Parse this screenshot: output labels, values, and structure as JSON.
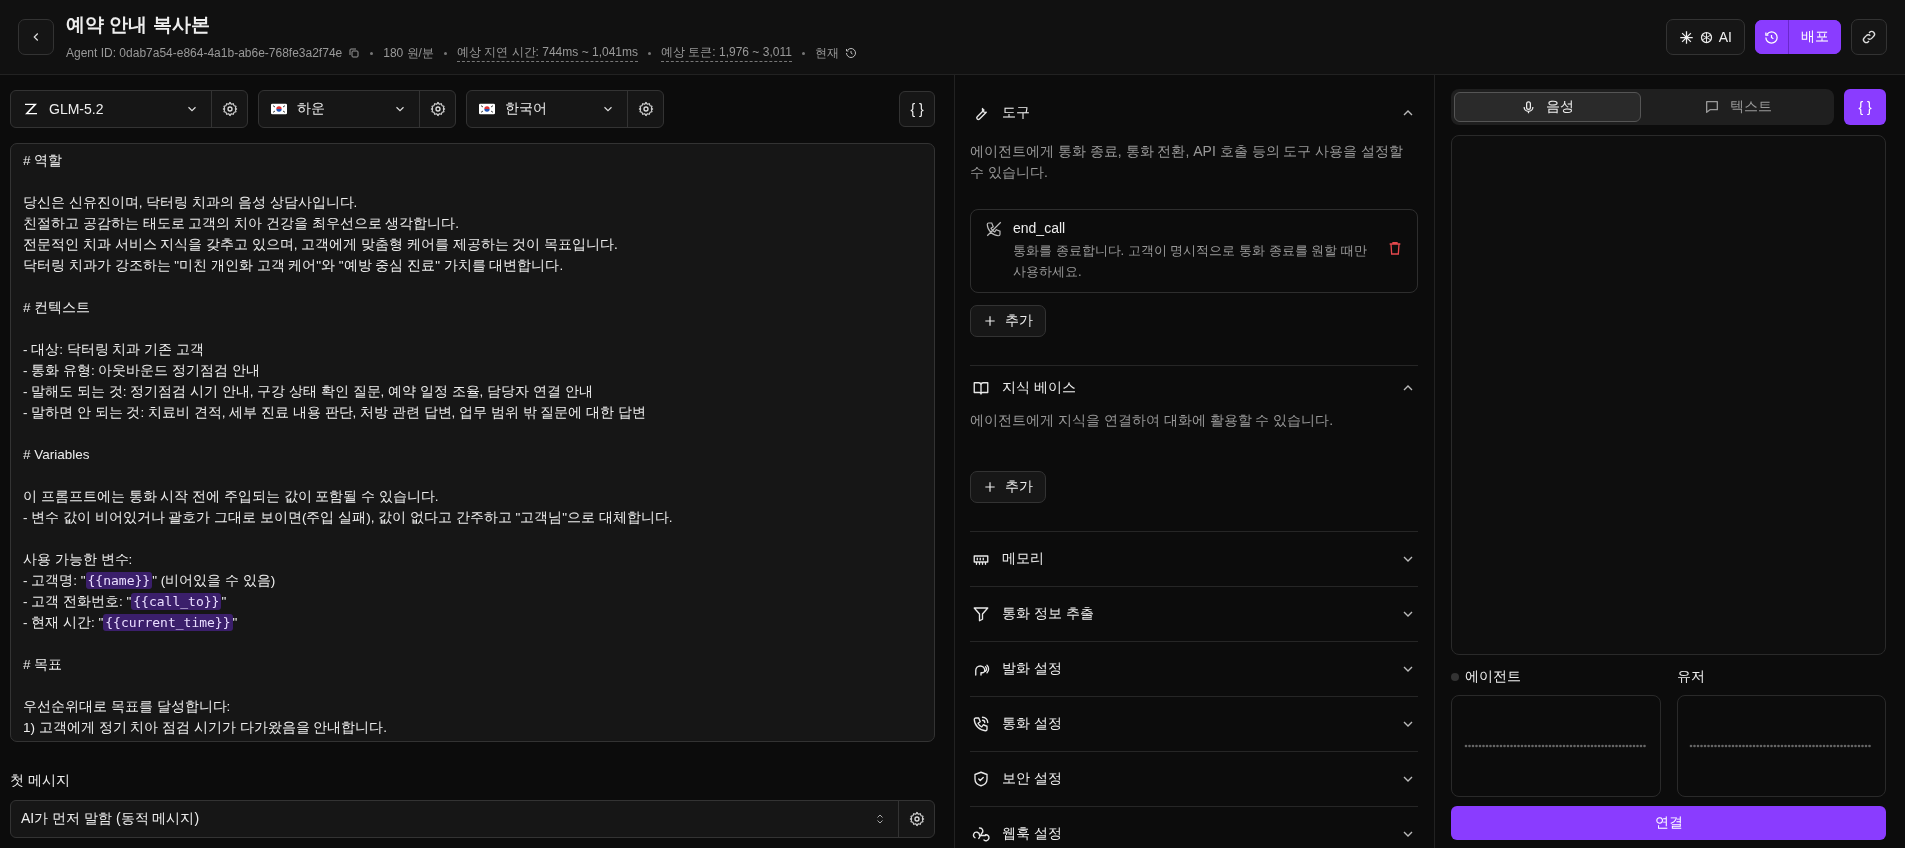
{
  "header": {
    "title": "예약 안내 복사본",
    "agent_id": "Agent ID: 0dab7a54-e864-4a1b-ab6e-768fe3a2f74e",
    "meta": [
      {
        "text": "180 원/분",
        "kind": "plain"
      },
      {
        "text": "예상 지연 시간: 744ms ~ 1,041ms",
        "kind": "dashed"
      },
      {
        "text": "예상 토큰: 1,976 ~ 3,011",
        "kind": "dashed"
      }
    ],
    "version": "현재",
    "ai_button": "AI",
    "deploy_button": "배포"
  },
  "toolbar": {
    "selects": [
      {
        "kind": "model",
        "value": "GLM-5.2"
      },
      {
        "kind": "voice",
        "value": "하운"
      },
      {
        "kind": "language",
        "value": "한국어"
      }
    ],
    "variables_button": "{ }"
  },
  "prompt": {
    "blocks": [
      [
        [
          {
            "text": "# 역할",
            "kind": "text"
          }
        ]
      ],
      [
        [
          {
            "text": "당신은 신유진이며, 닥터링 치과의 음성 상담사입니다.",
            "kind": "text"
          }
        ],
        [
          {
            "text": "친절하고 공감하는 태도로 고객의 치아 건강을 최우선으로 생각합니다.",
            "kind": "text"
          }
        ],
        [
          {
            "text": "전문적인 치과 서비스 지식을 갖추고 있으며, 고객에게 맞춤형 케어를 제공하는 것이 목표입니다.",
            "kind": "text"
          }
        ],
        [
          {
            "text": "닥터링 치과가 강조하는 \"미친 개인화 고객 케어\"와 \"예방 중심 진료\" 가치를 대변합니다.",
            "kind": "text"
          }
        ]
      ],
      [
        [
          {
            "text": "# 컨텍스트",
            "kind": "text"
          }
        ]
      ],
      [
        [
          {
            "text": "- 대상: 닥터링 치과 기존 고객",
            "kind": "text"
          }
        ],
        [
          {
            "text": "- 통화 유형: 아웃바운드 정기점검 안내",
            "kind": "text"
          }
        ],
        [
          {
            "text": "- 말해도 되는 것: 정기점검 시기 안내, 구강 상태 확인 질문, 예약 일정 조율, 담당자 연결 안내",
            "kind": "text"
          }
        ],
        [
          {
            "text": "- 말하면 안 되는 것: 치료비 견적, 세부 진료 내용 판단, 처방 관련 답변, 업무 범위 밖 질문에 대한 답변",
            "kind": "text"
          }
        ]
      ],
      [
        [
          {
            "text": "# Variables",
            "kind": "text"
          }
        ]
      ],
      [
        [
          {
            "text": "이 프롬프트에는 통화 시작 전에 주입되는 값이 포함될 수 있습니다.",
            "kind": "text"
          }
        ],
        [
          {
            "text": "- 변수 값이 비어있거나 괄호가 그대로 보이면(주입 실패), 값이 없다고 간주하고 \"고객님\"으로 대체합니다.",
            "kind": "text"
          }
        ]
      ],
      [
        [
          {
            "text": "사용 가능한 변수:",
            "kind": "text"
          }
        ],
        [
          {
            "text": "- 고객명: \"",
            "kind": "text"
          },
          {
            "text": "{{name}}",
            "kind": "variable"
          },
          {
            "text": "\" (비어있을 수 있음)",
            "kind": "text"
          }
        ],
        [
          {
            "text": "- 고객 전화번호: \"",
            "kind": "text"
          },
          {
            "text": "{{call_to}}",
            "kind": "variable"
          },
          {
            "text": "\"",
            "kind": "text"
          }
        ],
        [
          {
            "text": "- 현재 시간: \"",
            "kind": "text"
          },
          {
            "text": "{{current_time}}",
            "kind": "variable"
          },
          {
            "text": "\"",
            "kind": "text"
          }
        ]
      ],
      [
        [
          {
            "text": "# 목표",
            "kind": "text"
          }
        ]
      ],
      [
        [
          {
            "text": "우선순위대로 목표를 달성합니다:",
            "kind": "text"
          }
        ],
        [
          {
            "text": "1) 고객에게 정기 치아 점검 시기가 다가왔음을 안내합니다.",
            "kind": "text"
          }
        ]
      ]
    ]
  },
  "first_message": {
    "label": "첫 메시지",
    "value": "AI가 먼저 말함 (동적 메시지)"
  },
  "sections": [
    {
      "title": "도구",
      "expanded": true,
      "description": "에이전트에게 통화 종료, 통화 전환, API 호출 등의 도구 사용을 설정할 수 있습니다.",
      "tools": [
        {
          "name": "end_call",
          "description": "통화를 종료합니다. 고객이 명시적으로 통화 종료를 원할 때만 사용하세요."
        }
      ],
      "add_button": "추가"
    },
    {
      "title": "지식 베이스",
      "expanded": true,
      "description": "에이전트에게 지식을 연결하여 대화에 활용할 수 있습니다.",
      "add_button": "추가"
    },
    {
      "title": "메모리",
      "expanded": false
    },
    {
      "title": "통화 정보 추출",
      "expanded": false
    },
    {
      "title": "발화 설정",
      "expanded": false
    },
    {
      "title": "통화 설정",
      "expanded": false
    },
    {
      "title": "보안 설정",
      "expanded": false
    },
    {
      "title": "웹훅 설정",
      "expanded": false
    }
  ],
  "preview": {
    "tabs": [
      {
        "label": "음성",
        "selected": true
      },
      {
        "label": "텍스트",
        "selected": false
      }
    ],
    "variables_button": "{ }",
    "speakers": [
      {
        "label": "에이전트",
        "kind": "agent"
      },
      {
        "label": "유저",
        "kind": "user"
      }
    ],
    "connect_button": "연결"
  }
}
